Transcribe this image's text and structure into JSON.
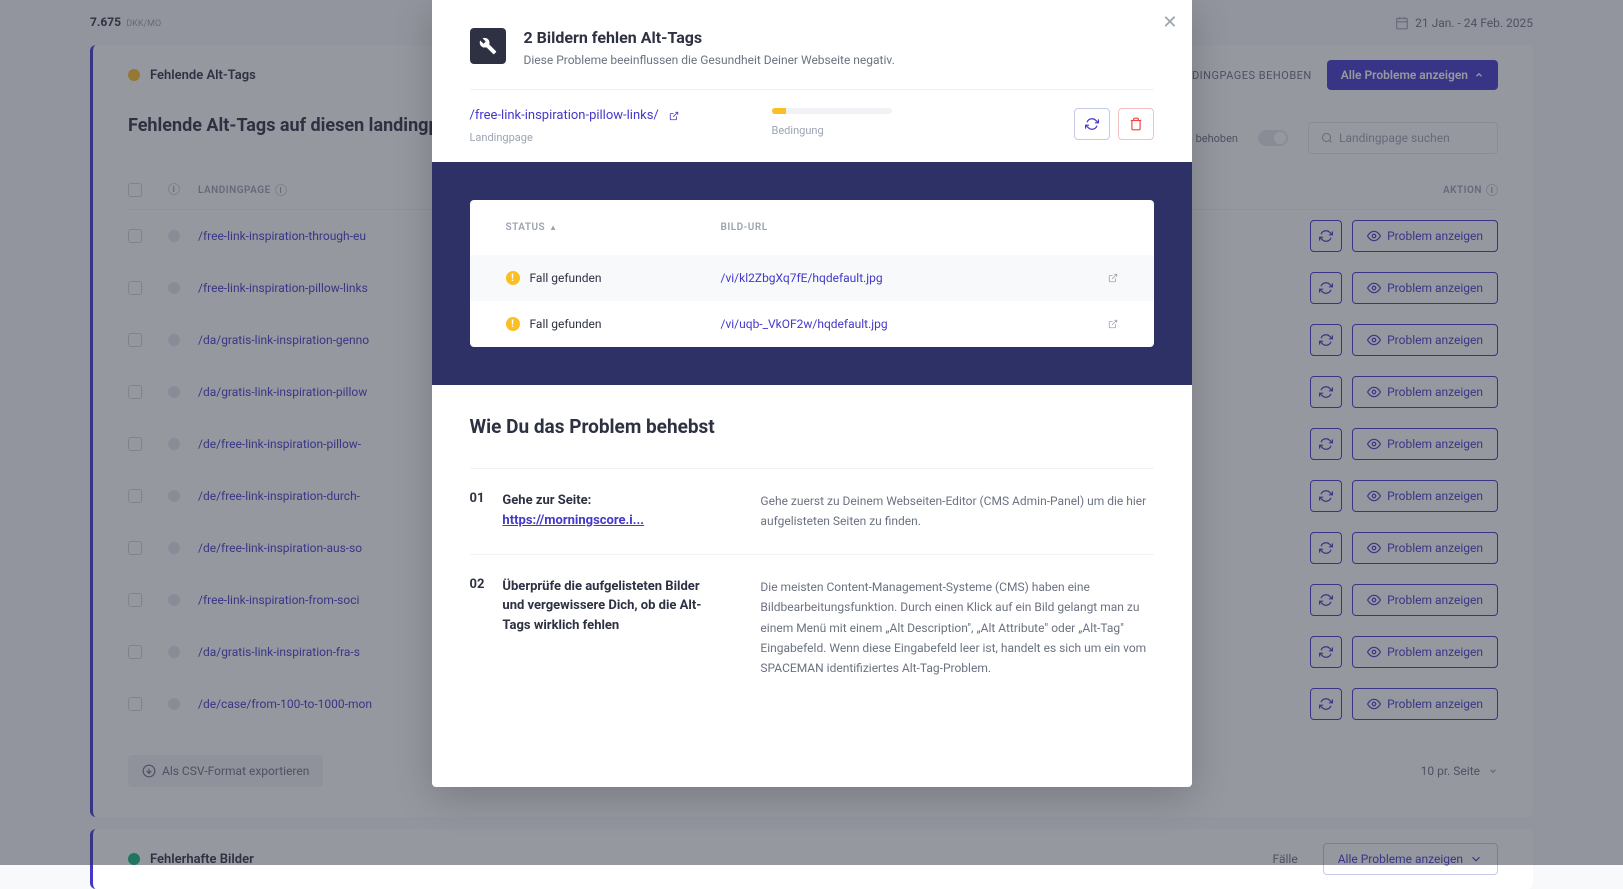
{
  "header": {
    "price": "7.675",
    "price_unit": "DKK/MO",
    "date_range": "21 Jan. - 24 Feb. 2025"
  },
  "bg_card": {
    "tag_title": "Fehlende Alt-Tags",
    "subtitle": "Fehlende Alt-Tags auf diesen landingpa",
    "resolved_label": "LANDINGPAGES BEHOBEN",
    "toggle_label": "n behoben",
    "search_placeholder": "Landingpage suchen",
    "show_all_btn": "Alle Probleme anzeigen",
    "col_landingpage": "LANDINGPAGE",
    "col_aktion": "AKTION",
    "problem_btn": "Problem anzeigen",
    "export_btn": "Als CSV-Format exportieren",
    "pager": "10 pr. Seite",
    "rows": [
      "/free-link-inspiration-through-eu",
      "/free-link-inspiration-pillow-links",
      "/da/gratis-link-inspiration-genno",
      "/da/gratis-link-inspiration-pillow",
      "/de/free-link-inspiration-pillow-",
      "/de/free-link-inspiration-durch-",
      "/de/free-link-inspiration-aus-so",
      "/free-link-inspiration-from-soci",
      "/da/gratis-link-inspiration-fra-s",
      "/de/case/from-100-to-1000-mon"
    ]
  },
  "footer_card": {
    "title": "Fehlerhafte Bilder",
    "falle": "Fälle",
    "btn": "Alle Probleme anzeigen"
  },
  "modal": {
    "title": "2 Bildern fehlen Alt-Tags",
    "subtitle": "Diese Probleme beeinflussen die Gesundheit Deiner Webseite negativ.",
    "summary": {
      "url": "/free-link-inspiration-pillow-links/",
      "url_label": "Landingpage",
      "cond_label": "Bedingung"
    },
    "table": {
      "col_status": "STATUS",
      "col_url": "BILD-URL",
      "rows": [
        {
          "status": "Fall gefunden",
          "url": "/vi/kl2ZbgXq7fE/hqdefault.jpg"
        },
        {
          "status": "Fall gefunden",
          "url": "/vi/uqb-_VkOF2w/hqdefault.jpg"
        }
      ]
    },
    "howto": {
      "title": "Wie Du das Problem behebst",
      "items": [
        {
          "num": "01",
          "heading_prefix": "Gehe zur Seite:",
          "heading_link": "https://morningscore.i...",
          "body": "Gehe zuerst zu Deinem Webseiten-Editor (CMS Admin-Panel) um die hier aufgelisteten Seiten zu finden."
        },
        {
          "num": "02",
          "heading": "Überprüfe die aufgelisteten Bilder und vergewissere Dich, ob die Alt-Tags wirklich fehlen",
          "body": "Die meisten Content-Management-Systeme (CMS) haben eine Bildbearbeitungsfunktion. Durch einen Klick auf ein Bild gelangt man zu einem Menü mit einem „Alt Description\", „Alt Attribute\" oder „Alt-Tag\" Eingabefeld. Wenn diese Eingabefeld leer ist, handelt es sich um ein vom SPACEMAN identifiziertes Alt-Tag-Problem."
        }
      ]
    }
  }
}
